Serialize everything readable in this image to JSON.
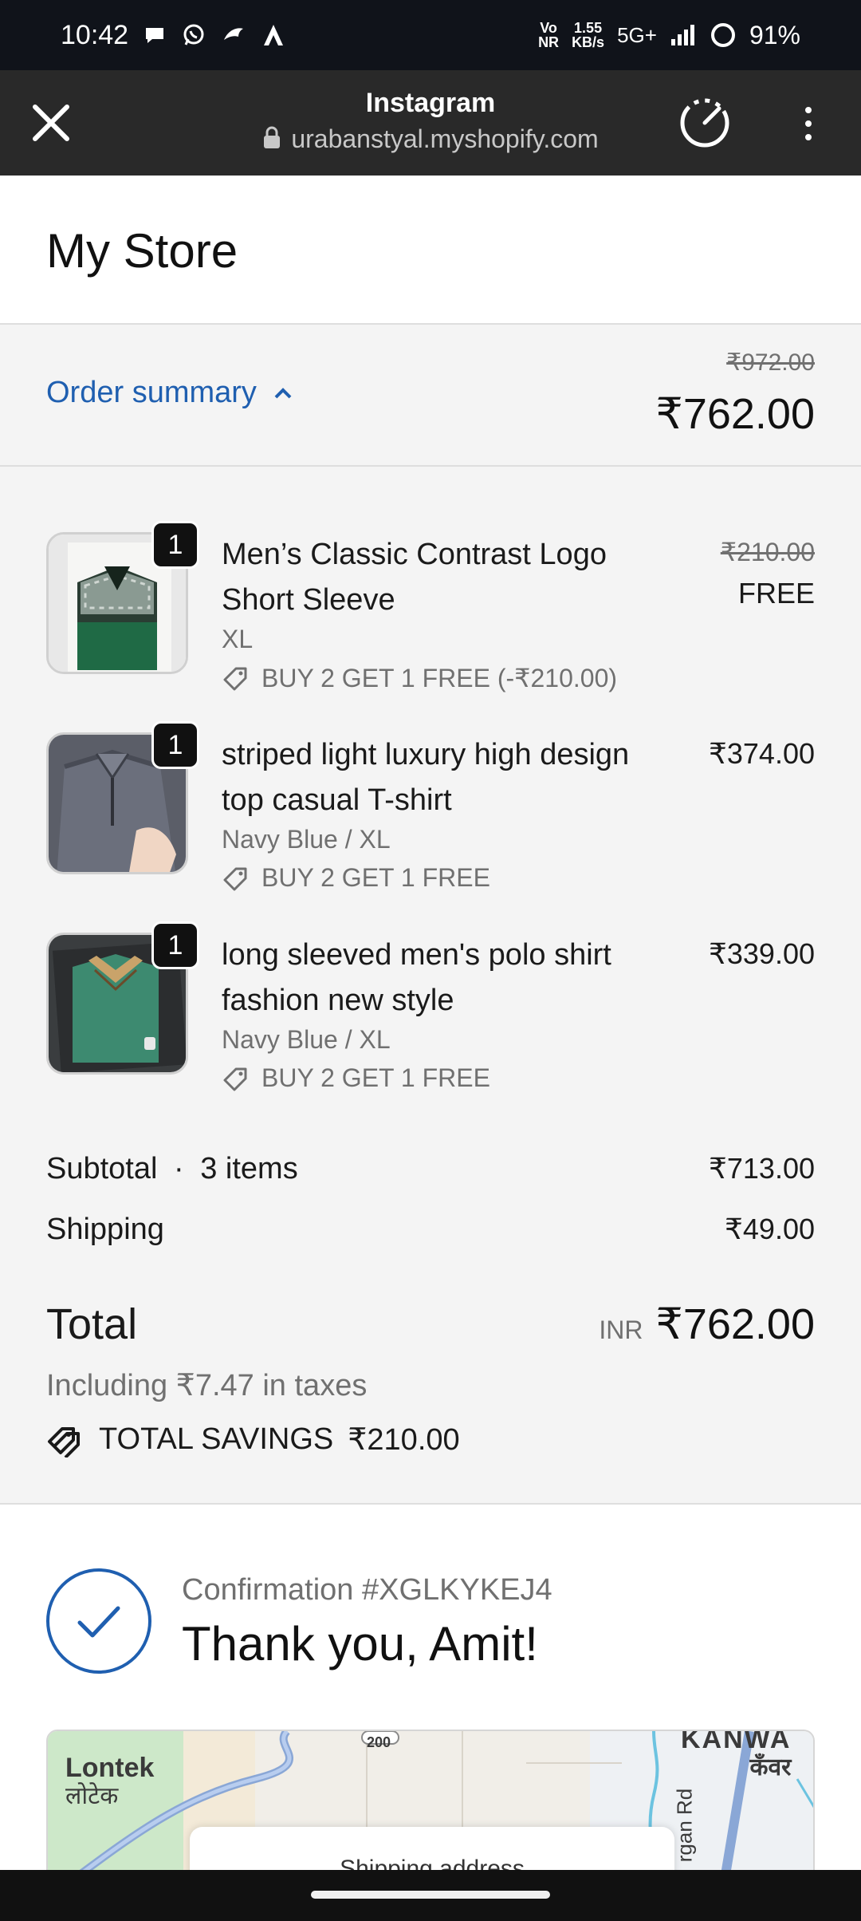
{
  "status_bar": {
    "time": "10:42",
    "network_top": "Vo",
    "network_bottom": "NR",
    "speed_top": "1.55",
    "speed_bottom": "KB/s",
    "signal": "5G+",
    "battery": "91%"
  },
  "browser": {
    "title": "Instagram",
    "url": "urabanstyal.myshopify.com",
    "icons": [
      "close-icon",
      "lock-icon",
      "speed-icon",
      "more-vert-icon"
    ]
  },
  "store": {
    "title": "My Store"
  },
  "summary": {
    "toggle_label": "Order summary",
    "original_total": "₹972.00",
    "total": "₹762.00"
  },
  "items": [
    {
      "name": "Men’s Classic Contrast Logo Short Sleeve",
      "variant": "XL",
      "discount": "BUY 2 GET 1 FREE (-₹210.00)",
      "price_old": "₹210.00",
      "price": "FREE",
      "quantity": "1"
    },
    {
      "name": "striped light luxury high design top casual T-shirt",
      "variant": "Navy Blue / XL",
      "discount": "BUY 2 GET 1 FREE",
      "price": "₹374.00",
      "quantity": "1"
    },
    {
      "name": "long sleeved men's polo shirt fashion new style",
      "variant": "Navy Blue / XL",
      "discount": "BUY 2 GET 1 FREE",
      "price": "₹339.00",
      "quantity": "1"
    }
  ],
  "totals": {
    "subtotal_label": "Subtotal",
    "subtotal_sep": "·",
    "subtotal_items": "3 items",
    "subtotal_value": "₹713.00",
    "shipping_label": "Shipping",
    "shipping_value": "₹49.00",
    "total_label": "Total",
    "currency": "INR",
    "total_value": "₹762.00",
    "tax_note": "Including ₹7.47 in taxes",
    "savings_label": "TOTAL SAVINGS",
    "savings_value": "₹210.00"
  },
  "confirmation": {
    "number": "Confirmation #XGLKYKEJ4",
    "thanks": "Thank you, Amit!"
  },
  "map": {
    "place_en": "Lontek",
    "place_hi": "लोटेक",
    "place_right_en": "KANWA",
    "place_right_hi": "कँवर",
    "road": "rgan Rd",
    "highway": "200",
    "card_text": "Shipping address"
  },
  "colors": {
    "accent": "#1f5fb0",
    "status_bar": "#10131a",
    "browser_bar": "#292929",
    "page_bg": "#f4f4f4"
  }
}
